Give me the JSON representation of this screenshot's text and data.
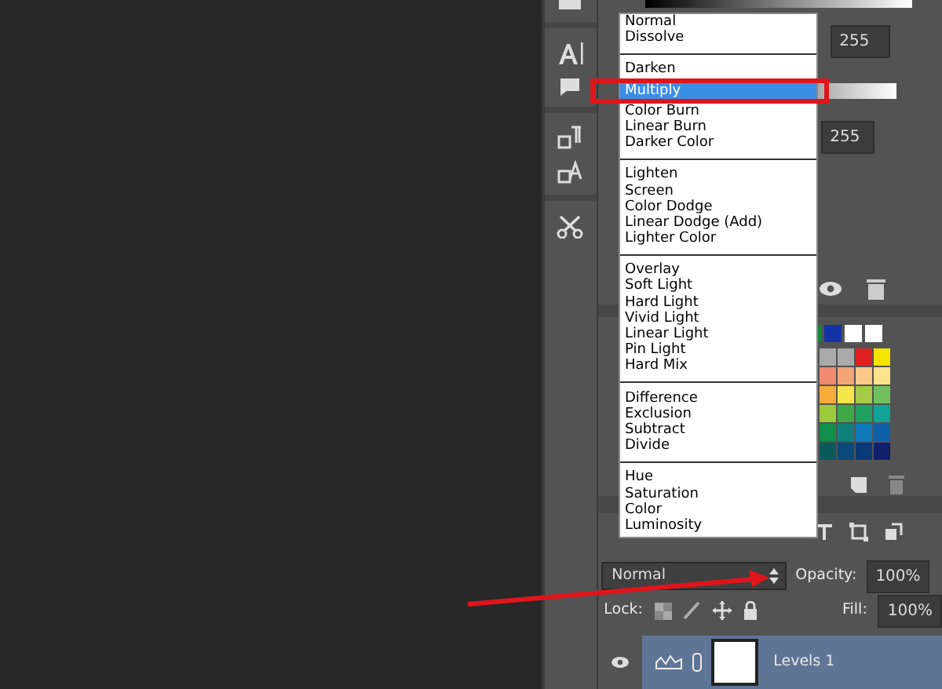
{
  "levels_panel": {
    "input_fields": [
      "255",
      "255"
    ]
  },
  "blend_menu": {
    "groups": [
      [
        {
          "label": "Normal",
          "selected": false
        },
        {
          "label": "Dissolve",
          "selected": false
        }
      ],
      [
        {
          "label": "Darken",
          "selected": false
        },
        {
          "label": "Multiply",
          "selected": true
        },
        {
          "label": "Color Burn",
          "selected": false
        },
        {
          "label": "Linear Burn",
          "selected": false
        },
        {
          "label": "Darker Color",
          "selected": false
        }
      ],
      [
        {
          "label": "Lighten",
          "selected": false
        },
        {
          "label": "Screen",
          "selected": false
        },
        {
          "label": "Color Dodge",
          "selected": false
        },
        {
          "label": "Linear Dodge (Add)",
          "selected": false
        },
        {
          "label": "Lighter Color",
          "selected": false
        }
      ],
      [
        {
          "label": "Overlay",
          "selected": false
        },
        {
          "label": "Soft Light",
          "selected": false
        },
        {
          "label": "Hard Light",
          "selected": false
        },
        {
          "label": "Vivid Light",
          "selected": false
        },
        {
          "label": "Linear Light",
          "selected": false
        },
        {
          "label": "Pin Light",
          "selected": false
        },
        {
          "label": "Hard Mix",
          "selected": false
        }
      ],
      [
        {
          "label": "Difference",
          "selected": false
        },
        {
          "label": "Exclusion",
          "selected": false
        },
        {
          "label": "Subtract",
          "selected": false
        },
        {
          "label": "Divide",
          "selected": false
        }
      ],
      [
        {
          "label": "Hue",
          "selected": false
        },
        {
          "label": "Saturation",
          "selected": false
        },
        {
          "label": "Color",
          "selected": false
        },
        {
          "label": "Luminosity",
          "selected": false
        }
      ]
    ]
  },
  "layers_panel": {
    "blend_mode": "Normal",
    "opacity_label": "Opacity:",
    "opacity": "100%",
    "lock_label": "Lock:",
    "fill_label": "Fill:",
    "fill": "100%",
    "layers": [
      {
        "name": "Levels 1",
        "selected": true
      }
    ]
  }
}
